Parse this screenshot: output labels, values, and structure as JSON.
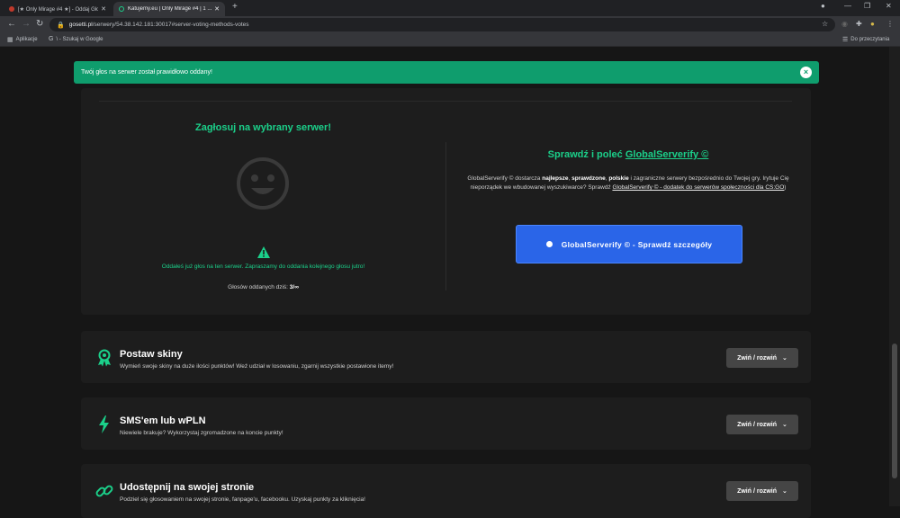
{
  "browser": {
    "tabs": [
      {
        "title": "[★ Only Mirage #4 ★] - Oddaj Głos",
        "active": false
      },
      {
        "title": "Katujemy.eu | Only Mirage #4 | 1 ...",
        "active": true
      }
    ],
    "url_host": "gosetti.pl",
    "url_path": "/serwery/54.38.142.181:30017#server-voting-methods-votes",
    "bookmarks": [
      {
        "label": "Aplikacje"
      },
      {
        "label": "\\ - Szukaj w Google"
      }
    ],
    "other_bookmarks": "Do przeczytania"
  },
  "alert": {
    "message": "Twój głos na serwer został prawidłowo oddany!",
    "close": "×"
  },
  "vote": {
    "title": "Zagłosuj na wybrany serwer!",
    "message": "Oddałeś już głos na ten serwer. Zapraszamy do oddania kolejnego głosu jutro!",
    "count_label": "Głosów oddanych dziś:",
    "count_value": "3/∞"
  },
  "globalserverify": {
    "title_prefix": "Sprawdź i poleć ",
    "title_link": "GlobalServerify ©",
    "desc_part1": "GlobalServerify © dostarcza ",
    "desc_bold1": "najlepsze",
    "desc_sep1": ", ",
    "desc_bold2": "sprawdzone",
    "desc_sep2": ", ",
    "desc_bold3": "polskie",
    "desc_part2": " i zagraniczne serwery bezpośrednio do Twojej gry. Irytuje Cię nieporządek we wbudowanej wyszukiwarce? Sprawdź ",
    "desc_link": "GlobalServerify © - dodatek do serwerów społeczności dla CS:GO",
    "desc_end": ")",
    "button": "GlobalServerify © - Sprawdź szczegóły"
  },
  "sections": [
    {
      "title": "Postaw skiny",
      "desc": "Wymień swoje skiny na duże ilości punktów! Weź udział w losowaniu, zgarnij wszystkie postawione itemy!",
      "toggle": "Zwiń / rozwiń",
      "icon": "award-icon"
    },
    {
      "title": "SMS'em lub wPLN",
      "desc": "Niewiele brakuje? Wykorzystaj zgromadzone na koncie punkty!",
      "toggle": "Zwiń / rozwiń",
      "icon": "lightning-icon"
    },
    {
      "title": "Udostępnij na swojej stronie",
      "desc": "Podziel się głosowaniem na swojej stronie, fanpage'u, facebooku. Uzyskaj punkty za kliknięcia!",
      "toggle": "Zwiń / rozwiń",
      "icon": "link-icon"
    }
  ],
  "colors": {
    "accent": "#1bd08a",
    "alert": "#0f9d6d",
    "button": "#2a65e8"
  }
}
